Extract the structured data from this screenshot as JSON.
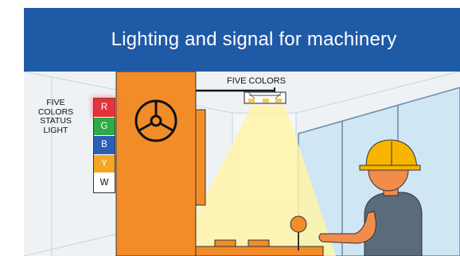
{
  "header": {
    "title": "Lighting and signal for machinery"
  },
  "status_light": {
    "caption_lines": [
      "FIVE",
      "COLORS",
      "STATUS",
      "LIGHT"
    ],
    "segments": [
      {
        "letter": "R",
        "color": "#e5323b"
      },
      {
        "letter": "G",
        "color": "#2eaa46"
      },
      {
        "letter": "B",
        "color": "#2b5fb5"
      },
      {
        "letter": "Y",
        "color": "#f5a623"
      },
      {
        "letter": "W",
        "color": "#ffffff"
      }
    ]
  },
  "ceiling_light": {
    "label": "FIVE COLORS"
  },
  "colors": {
    "title_bar": "#1f5aa6",
    "machine": "#f28c28",
    "helmet": "#f7b500",
    "skin": "#f28c4a",
    "body": "#5a6b7c",
    "window": "#cfe6f4",
    "beam": "#fff7b0",
    "lever_knob": "#f28c28"
  },
  "icons": [
    "steering-wheel-icon",
    "ceiling-lamp-icon",
    "worker-figure",
    "lever-icon"
  ]
}
